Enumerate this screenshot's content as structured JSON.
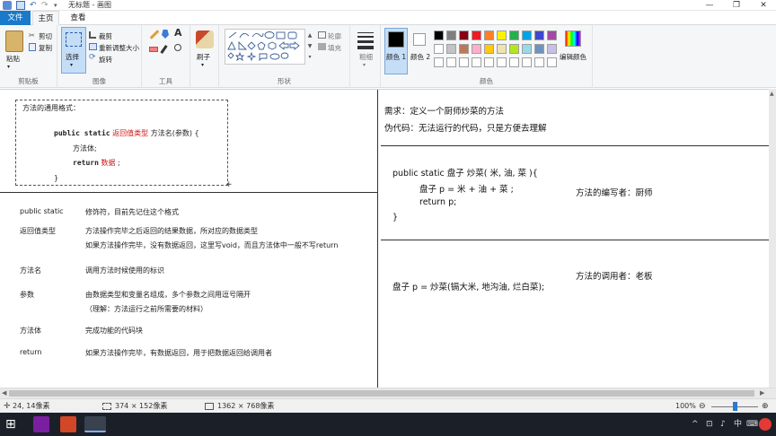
{
  "window": {
    "title": "无标题 - 画图",
    "min": "—",
    "max": "❐",
    "close": "✕"
  },
  "tabs": {
    "file": "文件",
    "home": "主页",
    "view": "查看"
  },
  "ribbon": {
    "clipboard": {
      "paste": "粘贴",
      "cut": "剪切",
      "copy": "复制",
      "label": "剪贴板"
    },
    "image": {
      "select": "选择",
      "crop": "裁剪",
      "resize": "重新调整大小",
      "rotate": "旋转",
      "label": "图像"
    },
    "tools": {
      "label": "工具"
    },
    "brushes": {
      "label": "刷子"
    },
    "shapes": {
      "outline": "轮廓",
      "fill": "填充",
      "label": "形状"
    },
    "size": {
      "label": "粗细"
    },
    "colors": {
      "color1": "颜色 1",
      "color2": "颜色 2",
      "edit": "编辑颜色",
      "label": "颜色",
      "palette_row1": [
        "#000000",
        "#7f7f7f",
        "#880015",
        "#ed1c24",
        "#ff7f27",
        "#fff200",
        "#22b14c",
        "#00a2e8",
        "#3f48cc",
        "#a349a4"
      ],
      "palette_row2": [
        "#ffffff",
        "#c3c3c3",
        "#b97a57",
        "#ffaec9",
        "#ffc90e",
        "#efe4b0",
        "#b5e61d",
        "#99d9ea",
        "#7092be",
        "#c8bfe7"
      ]
    }
  },
  "canvas": {
    "box": {
      "heading": "方法的通用格式：",
      "sig_kw": "public static",
      "sig_ret": "返回值类型",
      "sig_rest": "方法名(参数) {",
      "body": "方法体;",
      "ret_kw": "return",
      "ret_val": "数据",
      "ret_end": ";",
      "close": "}"
    },
    "defs": [
      {
        "term": "public static",
        "desc": [
          "修饰符，目前先记住这个格式"
        ]
      },
      {
        "term": "返回值类型",
        "desc": [
          "方法操作完毕之后返回的结果数据，所对应的数据类型",
          "如果方法操作完毕，没有数据返回，这里写void，而且方法体中一般不写return"
        ]
      },
      {
        "term": "方法名",
        "desc": [
          "调用方法时候使用的标识"
        ]
      },
      {
        "term": "参数",
        "desc": [
          "由数据类型和变量名组成，多个参数之间用逗号隔开",
          "（理解：方法运行之前所需要的材料）"
        ]
      },
      {
        "term": "方法体",
        "desc": [
          "完成功能的代码块"
        ]
      },
      {
        "term": "return",
        "desc": [
          "如果方法操作完毕，有数据返回，用于把数据返回给调用者"
        ]
      }
    ],
    "right": {
      "req": "需求：定义一个厨师炒菜的方法",
      "pseudo": "伪代码：无法运行的代码，只是方便去理解",
      "code1": "public static 盘子  炒菜( 米, 油, 菜 ){",
      "code2": "盘子 p = 米 + 油 + 菜 ;",
      "code3": "return p;",
      "code4": "}",
      "author": "方法的编写者：厨师",
      "caller": "方法的调用者：老板",
      "call": "盘子 p =  炒菜(镉大米, 地沟油, 烂白菜);"
    }
  },
  "status": {
    "cursor": "24, 14像素",
    "selection": "374 × 152像素",
    "canvas_size": "1362 × 768像素",
    "zoom": "100%"
  },
  "taskbar": {
    "ime": "中",
    "tray_up": "^"
  }
}
